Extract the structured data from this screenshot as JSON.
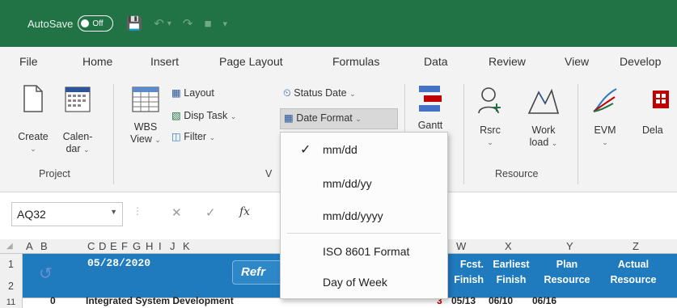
{
  "titlebar": {
    "autosave_label": "AutoSave",
    "toggle_label": "Off"
  },
  "menu": {
    "tabs": [
      "File",
      "Home",
      "Insert",
      "Page Layout",
      "Formulas",
      "Data",
      "Review",
      "View",
      "Develop"
    ]
  },
  "ribbon": {
    "create": "Create",
    "calen_1": "Calen-",
    "calen_2": "dar",
    "wbs_1": "WBS",
    "wbs_2": "View",
    "layout": "Layout",
    "disp_task": "Disp Task",
    "filter": "Filter",
    "status_date": "Status Date",
    "date_format": "Date Format",
    "gantt": "Gantt",
    "rsrc": "Rsrc",
    "work_1": "Work",
    "work_2": "load",
    "evm": "EVM",
    "delay": "Dela",
    "group_project": "Project",
    "group_v": "V",
    "group_resource": "Resource"
  },
  "formula_bar": {
    "name_box": "AQ32",
    "fx": "fx"
  },
  "grid": {
    "columns": [
      "A",
      "B",
      "C",
      "D",
      "E",
      "F",
      "G",
      "H",
      "I",
      "J",
      "K",
      "W",
      "X",
      "Y",
      "Z"
    ],
    "rows": [
      "1",
      "2",
      "11"
    ],
    "date": "05/28/2020",
    "refresh_label": "Refr",
    "header_cells": [
      {
        "line1": "Fcst.",
        "line2": "Finish"
      },
      {
        "line1": "Earliest",
        "line2": "Finish"
      },
      {
        "line1": "Plan",
        "line2": "Resource"
      },
      {
        "line1": "Actual",
        "line2": "Resource"
      }
    ],
    "row11": {
      "a": "0",
      "task": "Integrated System Development",
      "num": "3",
      "d1": "05/13",
      "d2": "06/10",
      "d3": "06/16"
    }
  },
  "dropdown": {
    "items": [
      "mm/dd",
      "mm/dd/yy",
      "mm/dd/yyyy",
      "ISO 8601 Format",
      "Day of Week"
    ],
    "checked_index": 0
  },
  "colors": {
    "title_green": "#217346",
    "header_blue": "#1f7bbd"
  }
}
